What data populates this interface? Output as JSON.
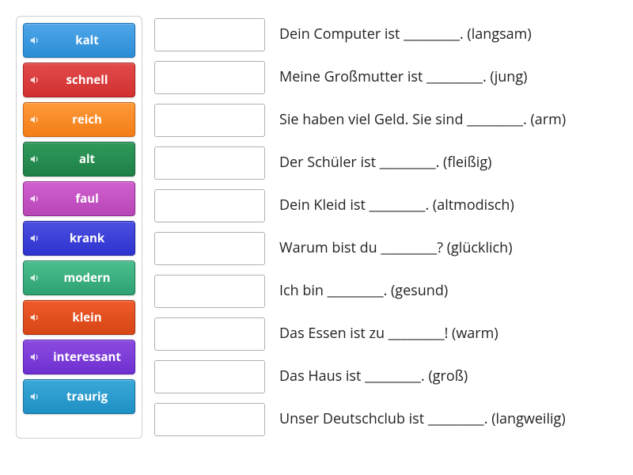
{
  "words": [
    {
      "label": "kalt",
      "color": "blue"
    },
    {
      "label": "schnell",
      "color": "red"
    },
    {
      "label": "reich",
      "color": "orange"
    },
    {
      "label": "alt",
      "color": "green"
    },
    {
      "label": "faul",
      "color": "magenta"
    },
    {
      "label": "krank",
      "color": "indigo"
    },
    {
      "label": "modern",
      "color": "teal"
    },
    {
      "label": "klein",
      "color": "dorange"
    },
    {
      "label": "interessant",
      "color": "purple"
    },
    {
      "label": "traurig",
      "color": "skyblue"
    }
  ],
  "sentences": [
    {
      "text": "Dein Computer ist _________. (langsam)"
    },
    {
      "text": "Meine Großmutter ist _________. (jung)"
    },
    {
      "text": "Sie haben viel Geld. Sie sind _________. (arm)"
    },
    {
      "text": "Der Schüler ist _________. (fleißig)"
    },
    {
      "text": "Dein Kleid ist _________. (altmodisch)"
    },
    {
      "text": "Warum bist du _________? (glücklich)"
    },
    {
      "text": "Ich bin _________. (gesund)"
    },
    {
      "text": "Das Essen ist zu _________! (warm)"
    },
    {
      "text": "Das Haus ist _________. (groß)"
    },
    {
      "text": "Unser Deutschclub ist _________. (langweilig)"
    }
  ]
}
